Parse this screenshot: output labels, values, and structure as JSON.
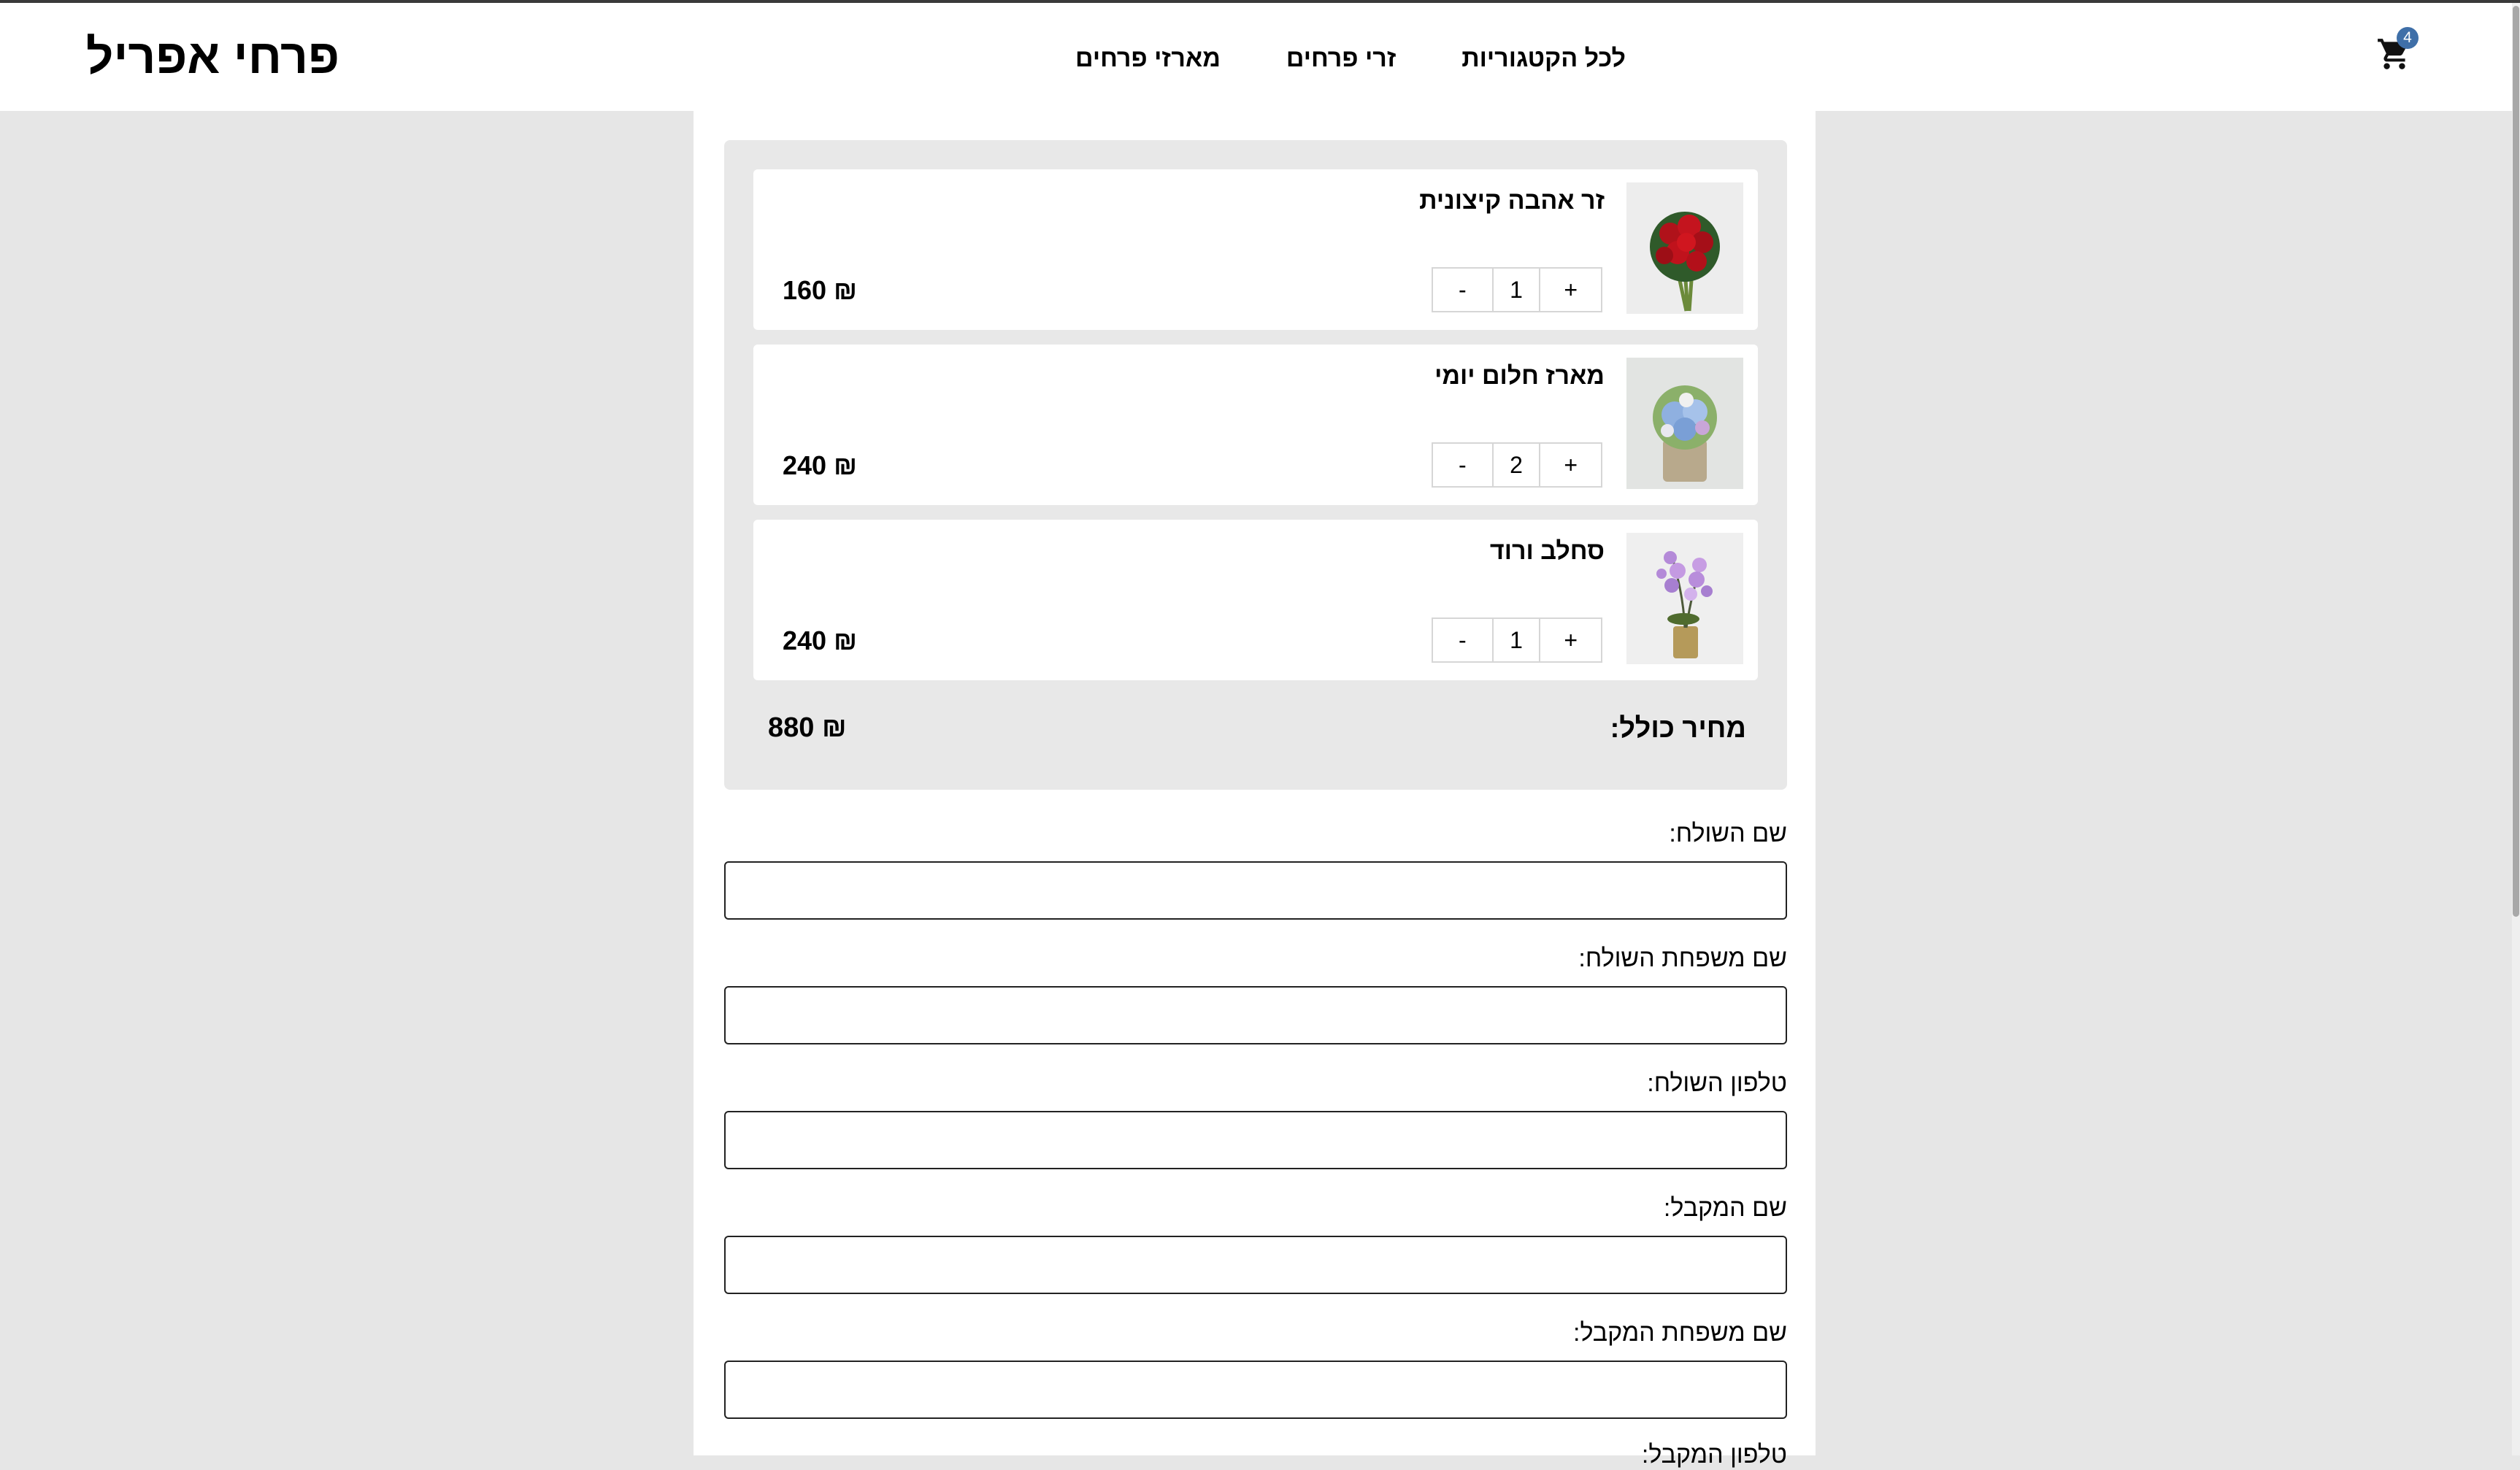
{
  "header": {
    "logo": "פרחי אפריל",
    "nav": [
      "לכל הקטגוריות",
      "זרי פרחים",
      "מארזי פרחים"
    ],
    "cart_count": "4"
  },
  "cart": {
    "items": [
      {
        "name": "זר אהבה קיצונית",
        "qty": "1",
        "price": "160 ₪",
        "image": "red-roses-bouquet"
      },
      {
        "name": "מארז חלום יומי",
        "qty": "2",
        "price": "240 ₪",
        "image": "blue-hydrangea-box"
      },
      {
        "name": "סחלב ורוד",
        "qty": "1",
        "price": "240 ₪",
        "image": "purple-orchid-pot"
      }
    ],
    "minus_label": "-",
    "plus_label": "+",
    "total_label": "מחיר כולל:",
    "total_value": "880 ₪"
  },
  "form": {
    "fields": [
      {
        "label": "שם השולח:",
        "value": ""
      },
      {
        "label": "שם משפחת השולח:",
        "value": ""
      },
      {
        "label": "טלפון השולח:",
        "value": ""
      },
      {
        "label": "שם המקבל:",
        "value": ""
      },
      {
        "label": "שם משפחת המקבל:",
        "value": ""
      },
      {
        "label": "טלפון המקבל:",
        "value": ""
      }
    ]
  },
  "colors": {
    "background": "#e6e6e6",
    "badge": "#3f6fa8"
  }
}
